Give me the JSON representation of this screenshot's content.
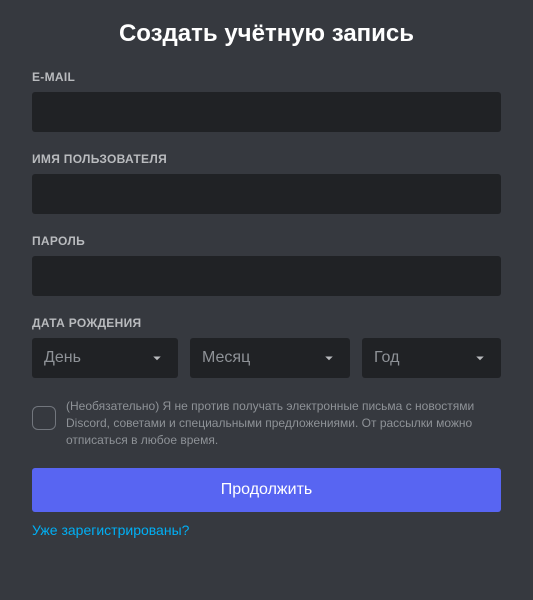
{
  "title": "Создать учётную запись",
  "fields": {
    "email": {
      "label": "E-MAIL",
      "value": ""
    },
    "username": {
      "label": "ИМЯ ПОЛЬЗОВАТЕЛЯ",
      "value": ""
    },
    "password": {
      "label": "ПАРОЛЬ",
      "value": ""
    }
  },
  "dob": {
    "label": "ДАТА РОЖДЕНИЯ",
    "day": {
      "placeholder": "День"
    },
    "month": {
      "placeholder": "Месяц"
    },
    "year": {
      "placeholder": "Год"
    }
  },
  "marketing": {
    "text": "(Необязательно) Я не против получать электронные письма с новостями Discord, советами и специальными предложениями. От рассылки можно отписаться в любое время."
  },
  "continue_label": "Продолжить",
  "login_link": "Уже зарегистрированы?"
}
